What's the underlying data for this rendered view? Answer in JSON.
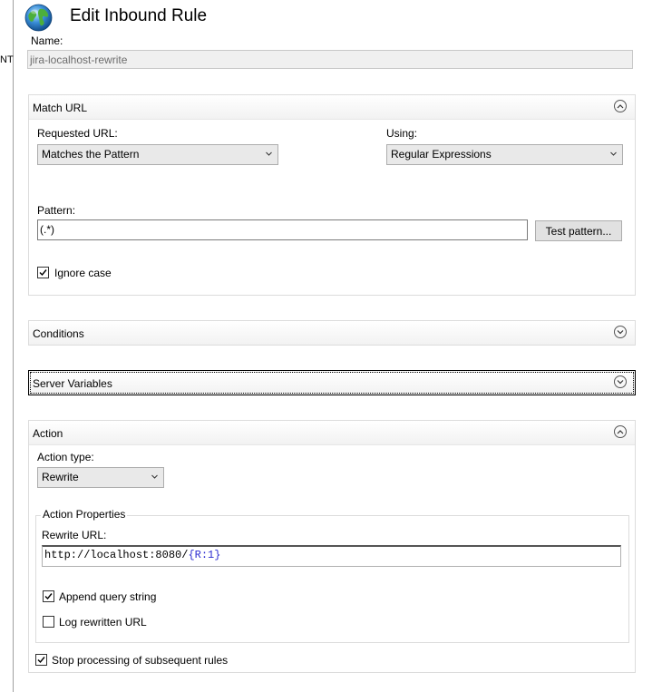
{
  "left_edge_fragment": "NT",
  "dialog": {
    "title": "Edit Inbound Rule",
    "name_label": "Name:",
    "name_value": "jira-localhost-rewrite"
  },
  "match_url": {
    "title": "Match URL",
    "requested_url_label": "Requested URL:",
    "requested_url_value": "Matches the Pattern",
    "using_label": "Using:",
    "using_value": "Regular Expressions",
    "pattern_label": "Pattern:",
    "pattern_value": "(.*)",
    "test_pattern_label": "Test pattern...",
    "ignore_case_label": "Ignore case",
    "ignore_case_checked": true
  },
  "conditions": {
    "title": "Conditions"
  },
  "server_variables": {
    "title": "Server Variables"
  },
  "action": {
    "title": "Action",
    "action_type_label": "Action type:",
    "action_type_value": "Rewrite",
    "properties_title": "Action Properties",
    "rewrite_url_label": "Rewrite URL:",
    "rewrite_url_prefix": "http://localhost:8080/",
    "rewrite_url_open": "{",
    "rewrite_url_var": "R:1",
    "rewrite_url_close": "}",
    "append_query_label": "Append query string",
    "append_query_checked": true,
    "log_rewritten_label": "Log rewritten URL",
    "log_rewritten_checked": false,
    "stop_processing_label": "Stop processing of subsequent rules",
    "stop_processing_checked": true
  },
  "colors": {
    "accent": "#0078d7",
    "brace": "#2b2bd0",
    "var": "#2b2bd0"
  }
}
